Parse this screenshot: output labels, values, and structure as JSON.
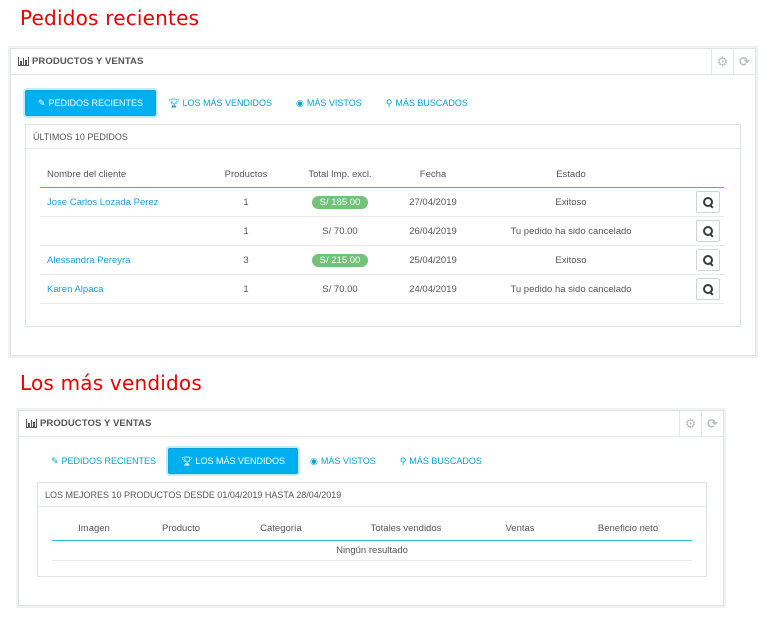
{
  "section1": {
    "heading": "Pedidos recientes",
    "panel_title": "PRODUCTOS Y VENTAS",
    "tabs": [
      {
        "label": "PEDIDOS RECIENTES",
        "icon": "pencil-icon"
      },
      {
        "label": "LOS MÁS VENDIDOS",
        "icon": "trophy-icon"
      },
      {
        "label": "MÁS VISTOS",
        "icon": "eye-icon"
      },
      {
        "label": "MÁS BUSCADOS",
        "icon": "search-icon"
      }
    ],
    "subpanel_title": "ÚLTIMOS 10 PEDIDOS",
    "columns": [
      "Nombre del cliente",
      "Productos",
      "Total Imp. excl.",
      "Fecha",
      "Estado"
    ],
    "rows": [
      {
        "customer": "Jose Carlos Lozada Perez",
        "products": "1",
        "total": "S/ 185.00",
        "date": "27/04/2019",
        "status": "Exitoso"
      },
      {
        "customer": "",
        "products": "1",
        "total": "S/ 70.00",
        "date": "26/04/2019",
        "status": "Tu pedido ha sido cancelado"
      },
      {
        "customer": "Alessandra Pereyra",
        "products": "3",
        "total": "S/ 215.00",
        "date": "25/04/2019",
        "status": "Exitoso"
      },
      {
        "customer": "Karen Alpaca",
        "products": "1",
        "total": "S/ 70.00",
        "date": "24/04/2019",
        "status": "Tu pedido ha sido cancelado"
      }
    ]
  },
  "section2": {
    "heading": "Los más vendidos",
    "panel_title": "PRODUCTOS Y VENTAS",
    "tabs": [
      {
        "label": "PEDIDOS RECIENTES",
        "icon": "pencil-icon"
      },
      {
        "label": "LOS MÁS VENDIDOS",
        "icon": "trophy-icon"
      },
      {
        "label": "MÁS VISTOS",
        "icon": "eye-icon"
      },
      {
        "label": "MÁS BUSCADOS",
        "icon": "search-icon"
      }
    ],
    "subpanel_title": "LOS MEJORES 10 PRODUCTOS DESDE 01/04/2019 HASTA 28/04/2019",
    "columns": [
      "Imagen",
      "Producto",
      "Categoría",
      "Totales vendidos",
      "Ventas",
      "Beneficio neto"
    ],
    "empty_message": "Ningún resultado"
  },
  "colors": {
    "heading": "#e60000",
    "accent": "#00aff0",
    "link": "#1c9dd8",
    "badge": "#72c279"
  }
}
